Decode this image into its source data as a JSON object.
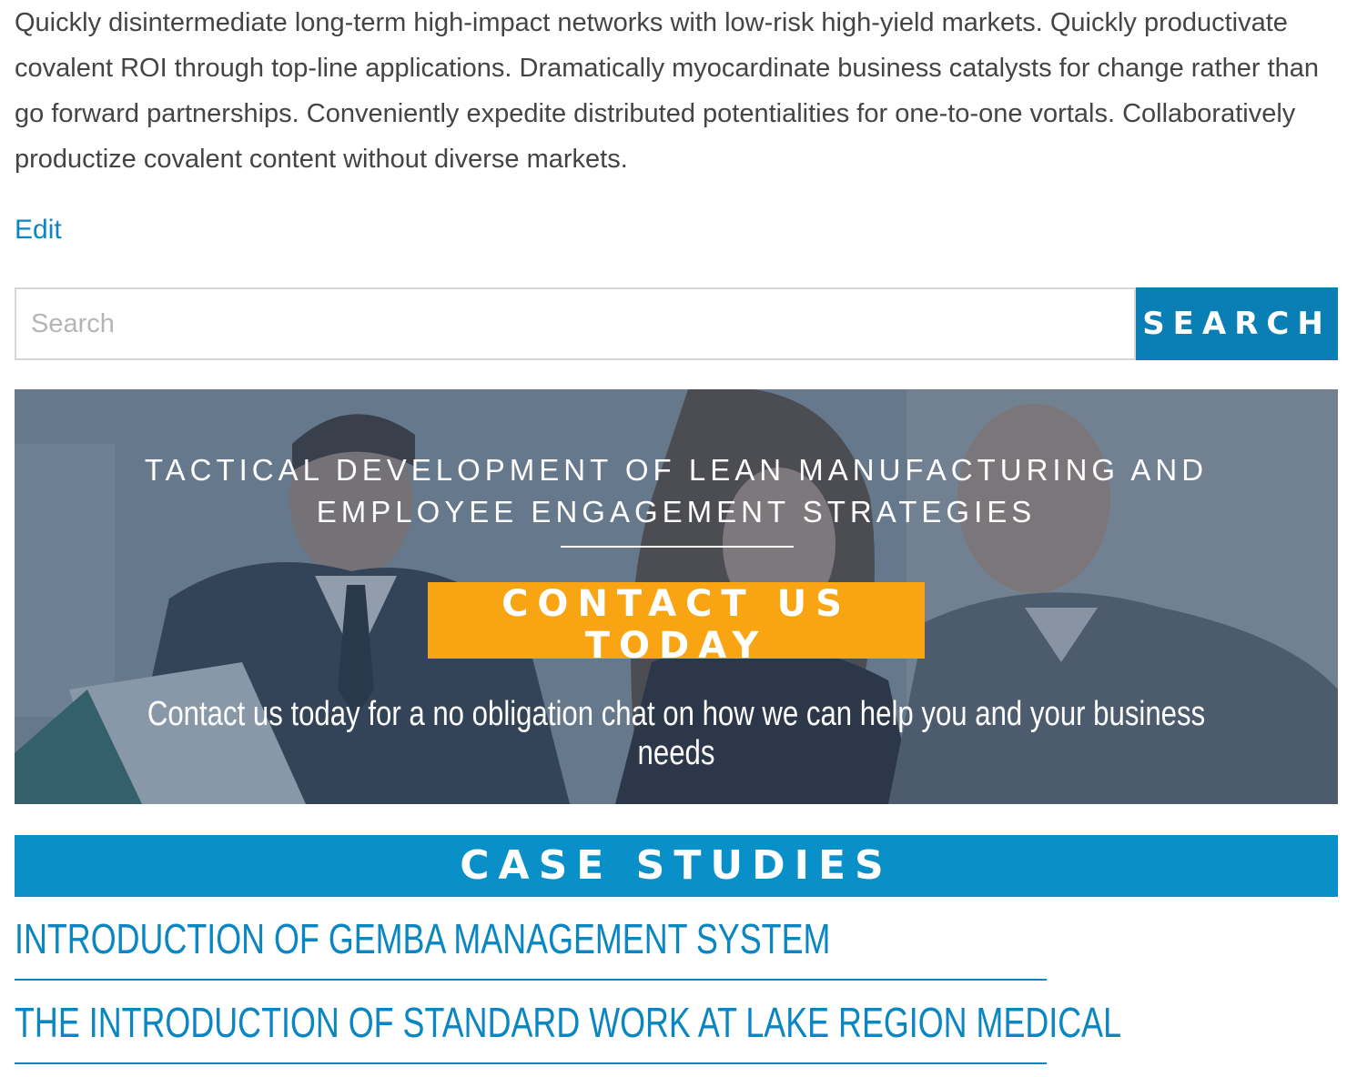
{
  "intro": {
    "text": "Quickly disintermediate long-term high-impact networks with low-risk high-yield markets. Quickly productivate covalent ROI through top-line applications. Dramatically myocardinate business catalysts for change rather than go forward partnerships. Conveniently expedite distributed potentialities for one-to-one vortals. Collaboratively productize covalent content without diverse markets."
  },
  "edit": {
    "label": "Edit"
  },
  "search": {
    "placeholder": "Search",
    "button_label": "SEARCH"
  },
  "hero": {
    "title": "TACTICAL DEVELOPMENT OF LEAN MANUFACTURING AND EMPLOYEE ENGAGEMENT STRATEGIES",
    "cta_label": "CONTACT US TODAY",
    "subtitle": "Contact us today for a no obligation chat on how we can help you and your business needs"
  },
  "case_studies": {
    "heading": "CASE STUDIES",
    "items": [
      {
        "title": "INTRODUCTION OF GEMBA MANAGEMENT SYSTEM"
      },
      {
        "title": "THE INTRODUCTION OF STANDARD WORK AT LAKE REGION MEDICAL"
      }
    ]
  },
  "colors": {
    "link": "#0a86c2",
    "search_button": "#0a7fb5",
    "cta": "#f9a513",
    "section_bar": "#0a90c8"
  }
}
